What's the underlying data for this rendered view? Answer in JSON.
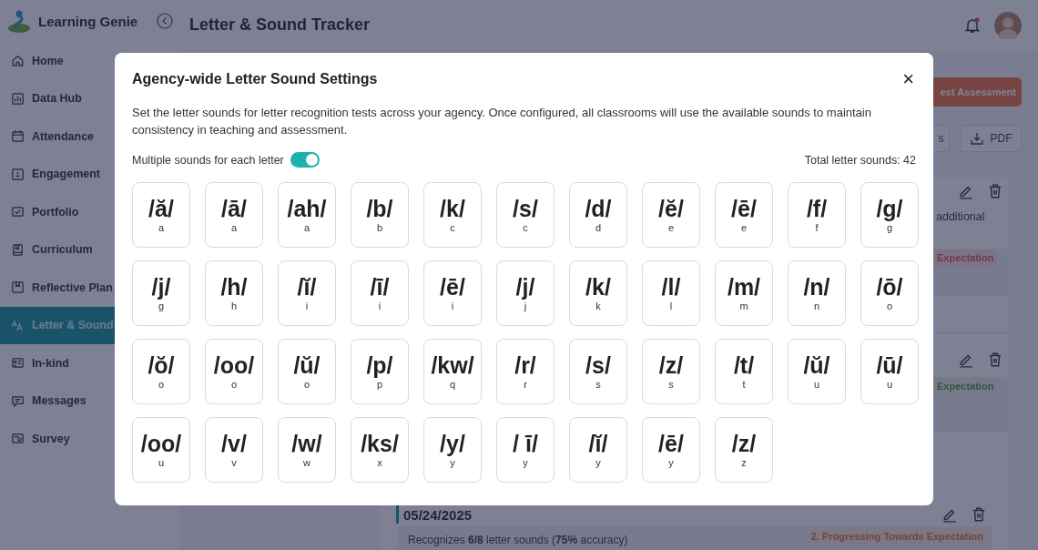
{
  "app": {
    "name": "Learning Genie"
  },
  "sidebar": {
    "items": [
      {
        "label": "Home",
        "selected": false
      },
      {
        "label": "Data Hub",
        "selected": false
      },
      {
        "label": "Attendance",
        "selected": false
      },
      {
        "label": "Engagement",
        "selected": false
      },
      {
        "label": "Portfolio",
        "selected": false
      },
      {
        "label": "Curriculum",
        "selected": false
      },
      {
        "label": "Reflective Plan",
        "selected": false
      },
      {
        "label": "Letter & Sound",
        "selected": true
      },
      {
        "label": "In-kind",
        "selected": false
      },
      {
        "label": "Messages",
        "selected": false
      },
      {
        "label": "Survey",
        "selected": false
      }
    ]
  },
  "header": {
    "title": "Letter & Sound Tracker",
    "notification_dot": true
  },
  "actions": {
    "assessment_button": "est Assessment",
    "button_2": "s",
    "pdf_button": "PDF"
  },
  "records": [
    {
      "text": "additional",
      "status": "Expectation",
      "kind": "needs"
    },
    {
      "status": "Expectation",
      "kind": "meets"
    },
    {
      "date": "05/24/2025",
      "status": "2. Progressing Towards Expectation",
      "kind": "progressing",
      "summary": "Recognizes **6/8** letter sounds (**75%** accuracy)"
    }
  ],
  "modal": {
    "title": "Agency-wide Letter Sound Settings",
    "close": "×",
    "description": "Set the letter sounds for letter recognition tests across your agency. Once configured, all classrooms will use the available sounds to maintain consistency in teaching and assessment.",
    "toggle": {
      "label": "Multiple sounds for each letter",
      "on": true
    },
    "total": "Total letter sounds: 42",
    "sounds": [
      {
        "sound": "/ă/",
        "letter": "a"
      },
      {
        "sound": "/ā/",
        "letter": "a"
      },
      {
        "sound": "/ah/",
        "letter": "a"
      },
      {
        "sound": "/b/",
        "letter": "b"
      },
      {
        "sound": "/k/",
        "letter": "c"
      },
      {
        "sound": "/s/",
        "letter": "c"
      },
      {
        "sound": "/d/",
        "letter": "d"
      },
      {
        "sound": "/ĕ/",
        "letter": "e"
      },
      {
        "sound": "/ē/",
        "letter": "e"
      },
      {
        "sound": "/f/",
        "letter": "f"
      },
      {
        "sound": "/g/",
        "letter": "g"
      },
      {
        "sound": "/j/",
        "letter": "g"
      },
      {
        "sound": "/h/",
        "letter": "h"
      },
      {
        "sound": "/ĭ/",
        "letter": "i"
      },
      {
        "sound": "/ī/",
        "letter": "i"
      },
      {
        "sound": "/ē/",
        "letter": "i"
      },
      {
        "sound": "/j/",
        "letter": "j"
      },
      {
        "sound": "/k/",
        "letter": "k"
      },
      {
        "sound": "/l/",
        "letter": "l"
      },
      {
        "sound": "/m/",
        "letter": "m"
      },
      {
        "sound": "/n/",
        "letter": "n"
      },
      {
        "sound": "/ō/",
        "letter": "o"
      },
      {
        "sound": "/ŏ/",
        "letter": "o"
      },
      {
        "sound": "/oo/",
        "letter": "o"
      },
      {
        "sound": "/ŭ/",
        "letter": "o"
      },
      {
        "sound": "/p/",
        "letter": "p"
      },
      {
        "sound": "/kw/",
        "letter": "q"
      },
      {
        "sound": "/r/",
        "letter": "r"
      },
      {
        "sound": "/s/",
        "letter": "s"
      },
      {
        "sound": "/z/",
        "letter": "s"
      },
      {
        "sound": "/t/",
        "letter": "t"
      },
      {
        "sound": "/ŭ/",
        "letter": "u"
      },
      {
        "sound": "/ū/",
        "letter": "u"
      },
      {
        "sound": "/oo/",
        "letter": "u"
      },
      {
        "sound": "/v/",
        "letter": "v"
      },
      {
        "sound": "/w/",
        "letter": "w"
      },
      {
        "sound": "/ks/",
        "letter": "x"
      },
      {
        "sound": "/y/",
        "letter": "y"
      },
      {
        "sound": "/ ī/",
        "letter": "y"
      },
      {
        "sound": "/ĭ/",
        "letter": "y"
      },
      {
        "sound": "/ē/",
        "letter": "y"
      },
      {
        "sound": "/z/",
        "letter": "z"
      }
    ]
  }
}
